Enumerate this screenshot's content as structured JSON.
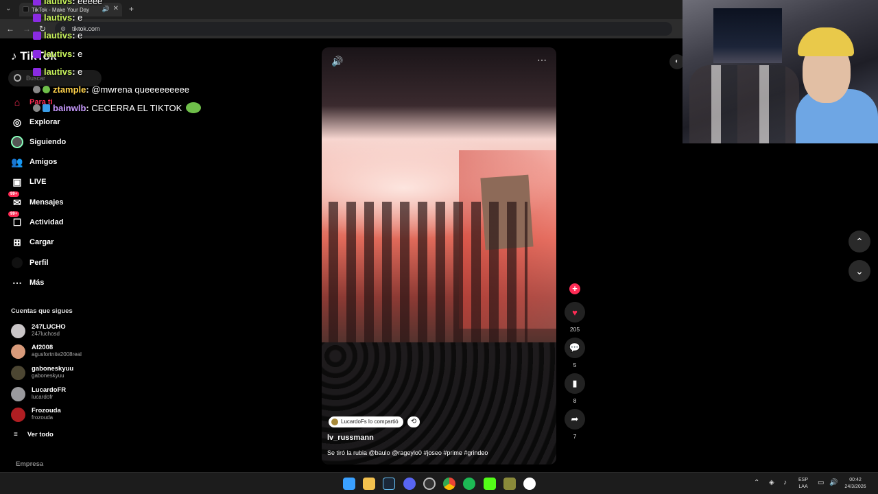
{
  "browser": {
    "tab_title": "TikTok - Make Your Day",
    "url": "tiktok.com"
  },
  "sidebar": {
    "logo": "TikTok",
    "search_placeholder": "Buscar",
    "nav": [
      {
        "label": "Para ti",
        "icon": "home-icon",
        "active": true
      },
      {
        "label": "Explorar",
        "icon": "compass-icon"
      },
      {
        "label": "Siguiendo",
        "icon": "following-avatar-icon"
      },
      {
        "label": "Amigos",
        "icon": "friends-icon"
      },
      {
        "label": "LIVE",
        "icon": "live-icon"
      },
      {
        "label": "Mensajes",
        "icon": "messages-icon",
        "badge": "99+"
      },
      {
        "label": "Actividad",
        "icon": "activity-icon",
        "badge": "99+"
      },
      {
        "label": "Cargar",
        "icon": "upload-icon"
      },
      {
        "label": "Perfil",
        "icon": "profile-icon"
      },
      {
        "label": "Más",
        "icon": "more-icon"
      }
    ],
    "following_title": "Cuentas que sigues",
    "following": [
      {
        "name": "247LUCHO",
        "handle": "247luchosd"
      },
      {
        "name": "Af2008",
        "handle": "agusfortnite2008real"
      },
      {
        "name": "gaboneskyuu",
        "handle": "gaboneskyuu"
      },
      {
        "name": "LucardoFR",
        "handle": "lucardofr"
      },
      {
        "name": "Frozouda",
        "handle": "frozouda"
      }
    ],
    "see_all": "Ver todo",
    "footer": "Empresa"
  },
  "chat": [
    {
      "user": "lautivs",
      "msg": "eeeee"
    },
    {
      "user": "lautivs",
      "msg": "e"
    },
    {
      "user": "lautivs",
      "msg": "e"
    },
    {
      "user": "lautivs",
      "msg": "e"
    },
    {
      "user": "lautivs",
      "msg": "e"
    },
    {
      "user": "ztample",
      "msg": "@mwrena queeeeeeeee"
    },
    {
      "user": "bainwlb",
      "msg": "CECERRA EL TIKTOK"
    }
  ],
  "video": {
    "shared_by": "LucardoFs lo compartió",
    "author": "lv_russmann",
    "caption": "Se tiró la rubia @baulo @rageylo0 #joseo #prime #grindeo"
  },
  "actions": {
    "likes": "205",
    "comments": "5",
    "saves": "8",
    "shares": "7"
  },
  "taskbar": {
    "lang_line1": "ESP",
    "lang_line2": "LAA",
    "time": "00:42",
    "date": "24/3/2026"
  },
  "colors": {
    "accent": "#fe2c55",
    "background": "#000000"
  }
}
